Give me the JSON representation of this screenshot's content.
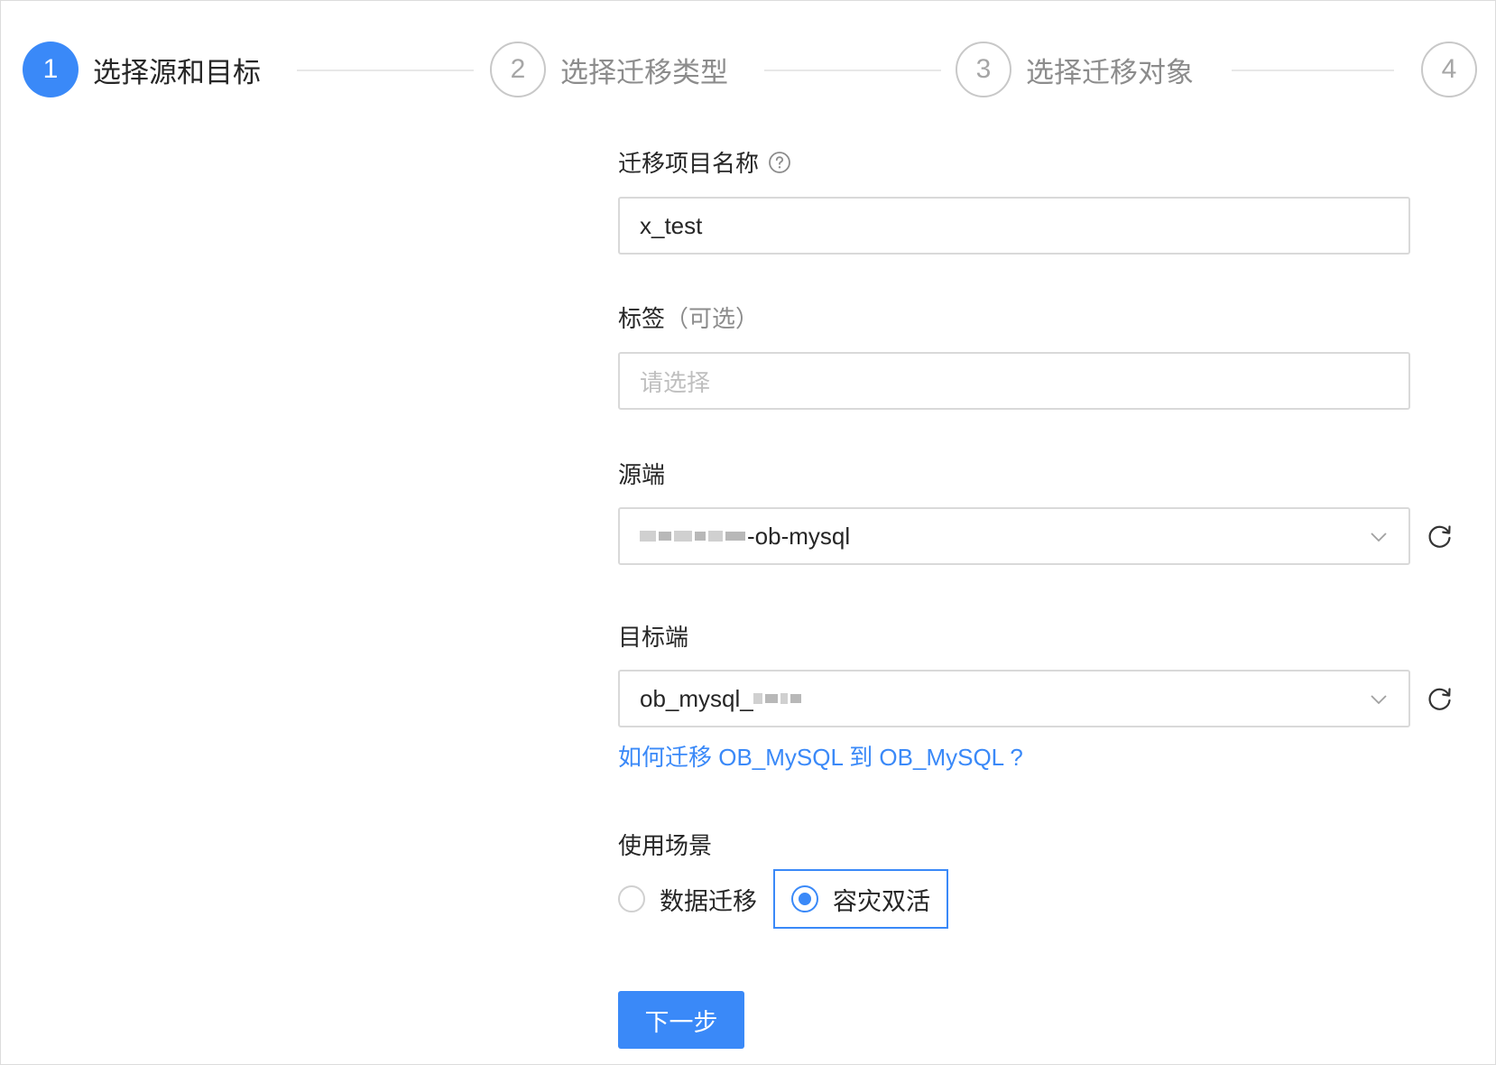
{
  "steps": [
    {
      "number": "1",
      "title": "选择源和目标",
      "status": "active"
    },
    {
      "number": "2",
      "title": "选择迁移类型",
      "status": "wait"
    },
    {
      "number": "3",
      "title": "选择迁移对象",
      "status": "wait"
    },
    {
      "number": "4",
      "title": "",
      "status": "wait"
    }
  ],
  "form": {
    "project_name": {
      "label": "迁移项目名称",
      "help_icon": "question-circle-icon",
      "value": "x_test"
    },
    "tags": {
      "label": "标签",
      "label_suffix": "（可选）",
      "placeholder": "请选择"
    },
    "source": {
      "label": "源端",
      "value_suffix": "-ob-mysql",
      "arrow_icon": "chevron-down-icon",
      "refresh_icon": "refresh-icon"
    },
    "target": {
      "label": "目标端",
      "value_prefix": "ob_mysql_",
      "arrow_icon": "chevron-down-icon",
      "refresh_icon": "refresh-icon"
    },
    "doc_link": "如何迁移 OB_MySQL 到 OB_MySQL ?",
    "scenario": {
      "label": "使用场景",
      "options": [
        {
          "label": "数据迁移",
          "checked": false
        },
        {
          "label": "容灾双活",
          "checked": true
        }
      ]
    },
    "next_button": "下一步"
  },
  "colors": {
    "primary": "#3a89f8",
    "border": "#d9d9d9",
    "muted": "#8c8c8c"
  }
}
